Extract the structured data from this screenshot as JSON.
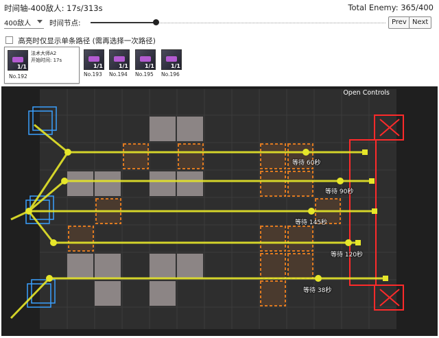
{
  "header": {
    "timeline_text": "时间轴-400敌人: 17s/313s",
    "total_enemy": "Total Enemy: 365/400"
  },
  "controls": {
    "enemy_select_value": "400敌人",
    "time_node_label": "时间节点:",
    "slider_fraction": 0.22,
    "prev_label": "Prev",
    "next_label": "Next"
  },
  "highlight_checkbox": {
    "label": "高亮时仅显示单条路径 (需再选择一次路径)",
    "checked": false
  },
  "enemies": {
    "selected": {
      "count": "1/1",
      "name": "法术大师A2",
      "time": "开始时间: 17s",
      "no": "No.192"
    },
    "others": [
      {
        "count": "1/1",
        "no": "No.193"
      },
      {
        "count": "1/1",
        "no": "No.194"
      },
      {
        "count": "1/1",
        "no": "No.195"
      },
      {
        "count": "1/1",
        "no": "No.196"
      }
    ]
  },
  "map": {
    "open_controls": "Open Controls",
    "wait_labels": [
      "等待 60秒",
      "等待 90秒",
      "等待 145秒",
      "等待 120秒",
      "等待 38秒"
    ],
    "colors": {
      "route": "#e6e62a",
      "blue_spawn": "#3aa0ff",
      "red_goal": "#ff2a2a",
      "orange_tile": "#e07a20"
    }
  }
}
